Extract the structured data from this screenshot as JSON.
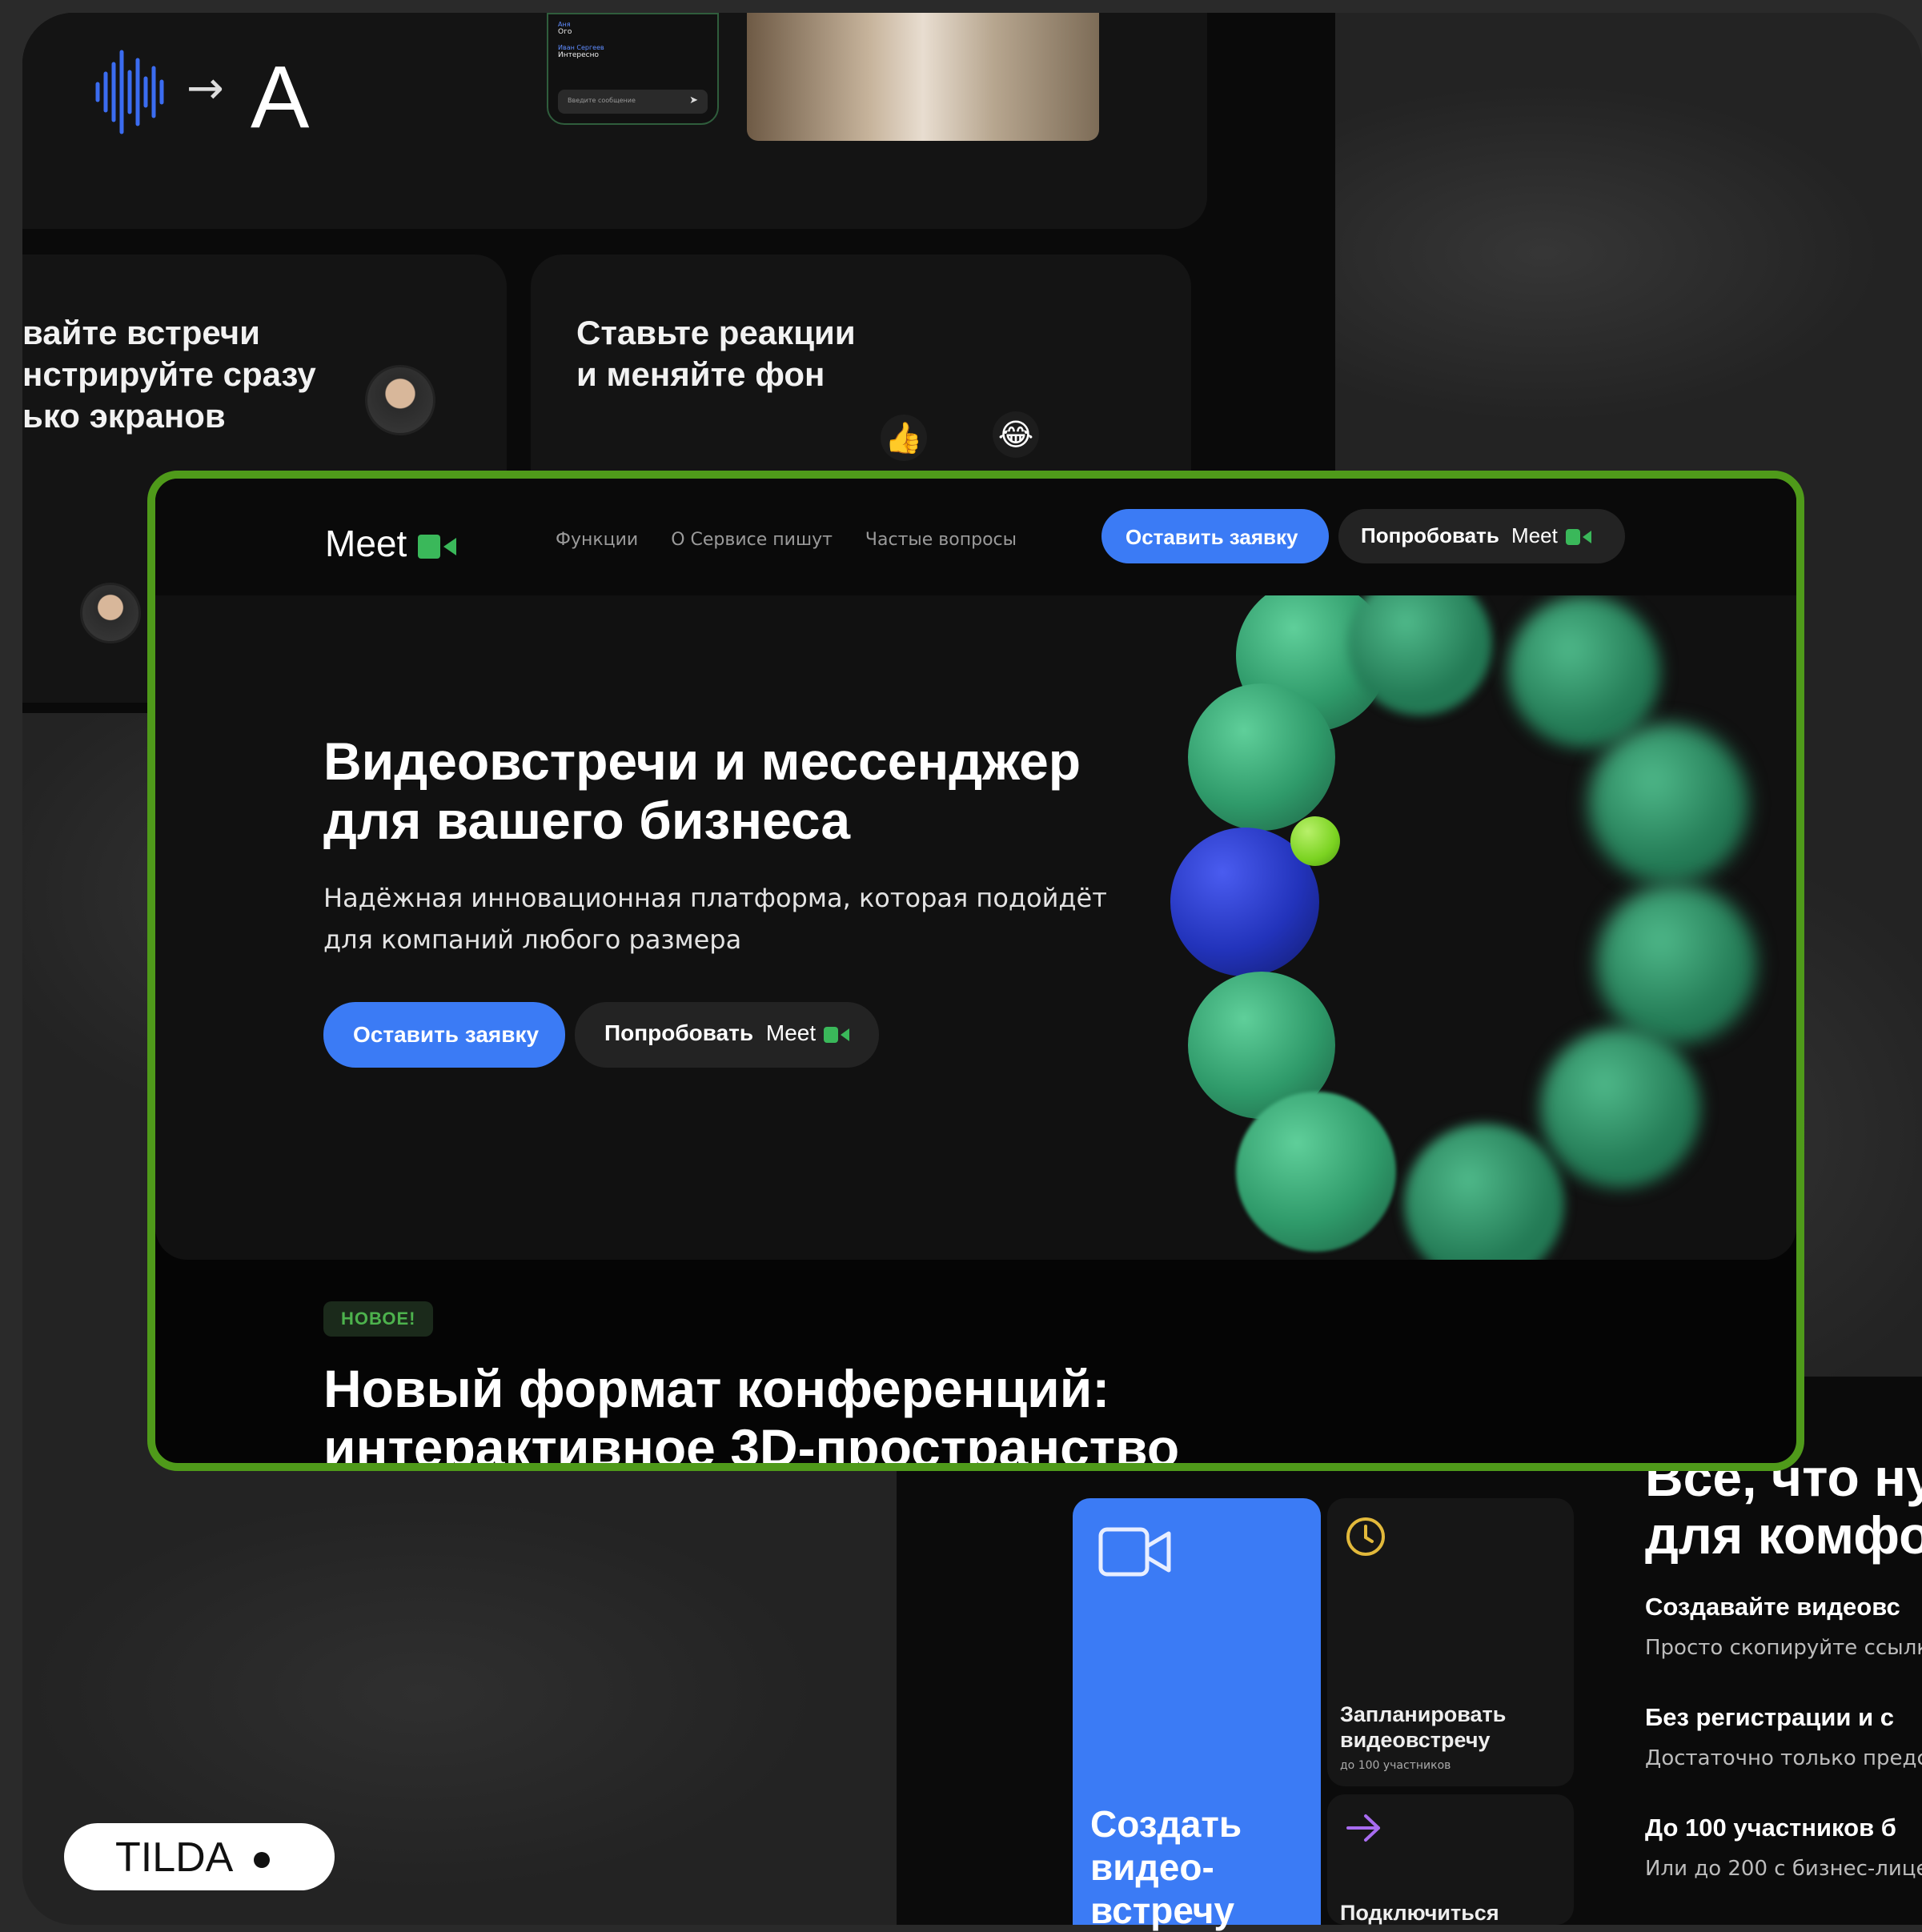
{
  "background": {
    "chat": {
      "messages": [
        {
          "name": "Аня",
          "text": "Ого"
        },
        {
          "name": "Иван Сергеев",
          "text": "Интересно"
        }
      ],
      "input_placeholder": "Введите сообщение"
    },
    "card_left_title": [
      "вайте встречи",
      "нстрируйте сразу",
      "ько экранов"
    ],
    "card_right_title": [
      "Ставьте реакции",
      "и меняйте фон"
    ],
    "emojis": [
      "👍",
      "😂"
    ]
  },
  "site": {
    "logo": "Meet",
    "nav": {
      "links": [
        "Функции",
        "О Сервисе пишут",
        "Частые вопросы"
      ],
      "cta_primary": "Оставить заявку",
      "cta_secondary": "Попробовать",
      "cta_secondary_brand": "Meet"
    },
    "hero": {
      "title_line1": "Видеовстречи и мессенджер",
      "title_line2": "для вашего бизнеса",
      "subtitle_line1": "Надёжная инновационная платформа, которая подойдёт",
      "subtitle_line2": "для компаний любого размера",
      "btn_primary": "Оставить заявку",
      "btn_secondary": "Попробовать",
      "btn_secondary_brand": "Meet"
    },
    "new_badge": "НОВОЕ!",
    "section_title_line1": "Новый формат конференций:",
    "section_title_line2": "интерактивное 3D-пространство"
  },
  "lower": {
    "big_card_title": [
      "Создать",
      "видео-",
      "встречу"
    ],
    "schedule_title": [
      "Запланировать",
      "видеовстречу"
    ],
    "schedule_sub": "до 100 участников",
    "join_title": "Подключиться",
    "features_heading": [
      "Все, что ну",
      "для комфо"
    ],
    "features": [
      {
        "title": "Создавайте видеовс",
        "desc": "Просто скопируйте ссылк"
      },
      {
        "title": "Без регистрации и с",
        "desc": "Достаточно только предс"
      },
      {
        "title": "До 100 участников б",
        "desc": "Или до 200 с бизнес-лице"
      }
    ]
  },
  "watermark": "TILDA",
  "colors": {
    "accent_blue": "#3b7bf5",
    "brand_green": "#3ab85a",
    "frame_green": "#4f9a1a",
    "sphere_teal": "#2f9a6a",
    "sphere_blue": "#2233bb",
    "sphere_lime": "#7bd321"
  }
}
